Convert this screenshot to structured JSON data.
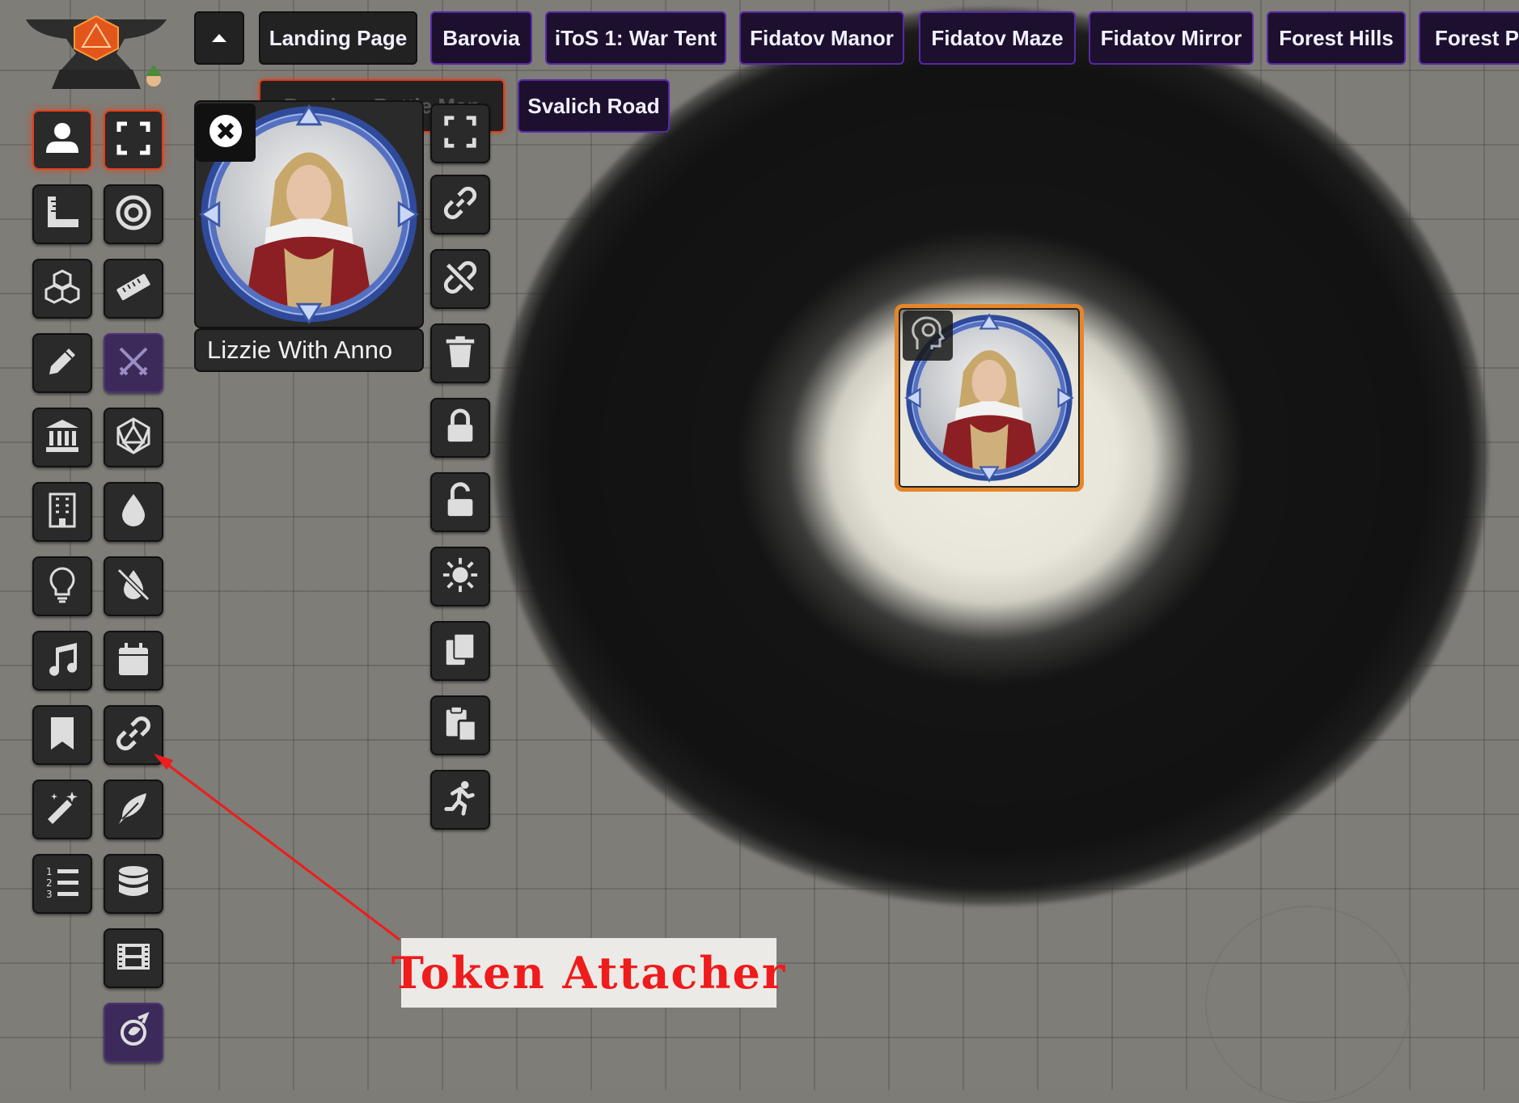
{
  "tabs": {
    "toggle_icon": "caret-up-icon",
    "scenes": [
      {
        "label": "Landing Page",
        "style": "grey"
      },
      {
        "label": "Barovia",
        "style": "purple"
      },
      {
        "label": "iToS 1: War Tent",
        "style": "purple"
      },
      {
        "label": "Fidatov Manor",
        "style": "purple"
      },
      {
        "label": "Fidatov Maze",
        "style": "purple"
      },
      {
        "label": "Fidatov Mirror",
        "style": "purple"
      },
      {
        "label": "Forest Hills",
        "style": "purple"
      },
      {
        "label": "Forest Po",
        "style": "purple"
      }
    ],
    "second_row": [
      {
        "label": "Random Battle Map",
        "style": "ghost"
      },
      {
        "label": "Svalich Road",
        "style": "purple"
      }
    ]
  },
  "toolbar": {
    "tools": [
      {
        "icon": "user-icon",
        "active": true
      },
      {
        "icon": "expand-icon",
        "active": true
      },
      {
        "icon": "ruler-square-icon"
      },
      {
        "icon": "target-icon"
      },
      {
        "icon": "cubes-icon"
      },
      {
        "icon": "ruler-icon"
      },
      {
        "icon": "pencil-icon"
      },
      {
        "icon": "crossed-swords-icon",
        "purple": true
      },
      {
        "icon": "landmark-icon"
      },
      {
        "icon": "d20-icon"
      },
      {
        "icon": "building-icon"
      },
      {
        "icon": "droplet-icon"
      },
      {
        "icon": "lightbulb-icon"
      },
      {
        "icon": "droplet-slash-icon"
      },
      {
        "icon": "music-icon"
      },
      {
        "icon": "calendar-icon"
      },
      {
        "icon": "bookmark-icon"
      },
      {
        "icon": "link-icon"
      },
      {
        "icon": "magic-wand-icon"
      },
      {
        "icon": "feather-icon"
      },
      {
        "icon": "list-ol-icon"
      },
      {
        "icon": "database-icon"
      },
      {
        "icon": "film-icon"
      },
      {
        "icon": "module-icon",
        "purple": true
      }
    ]
  },
  "token_hud": {
    "name": "Lizzie With Anno",
    "close_icon": "close-icon",
    "actions": [
      "expand-icon",
      "link-icon",
      "unlink-icon",
      "trash-icon",
      "lock-icon",
      "unlock-icon",
      "sun-icon",
      "copy-icon",
      "paste-icon",
      "running-icon"
    ]
  },
  "map": {
    "token_status_icon": "thinking-head-icon",
    "accent_color": "#e6862a"
  },
  "annotation": {
    "label": "Token Attacher",
    "color": "#ee1c1c"
  },
  "colors": {
    "active_glow": "#e0401b",
    "tab_purple": "#5a28a8"
  }
}
